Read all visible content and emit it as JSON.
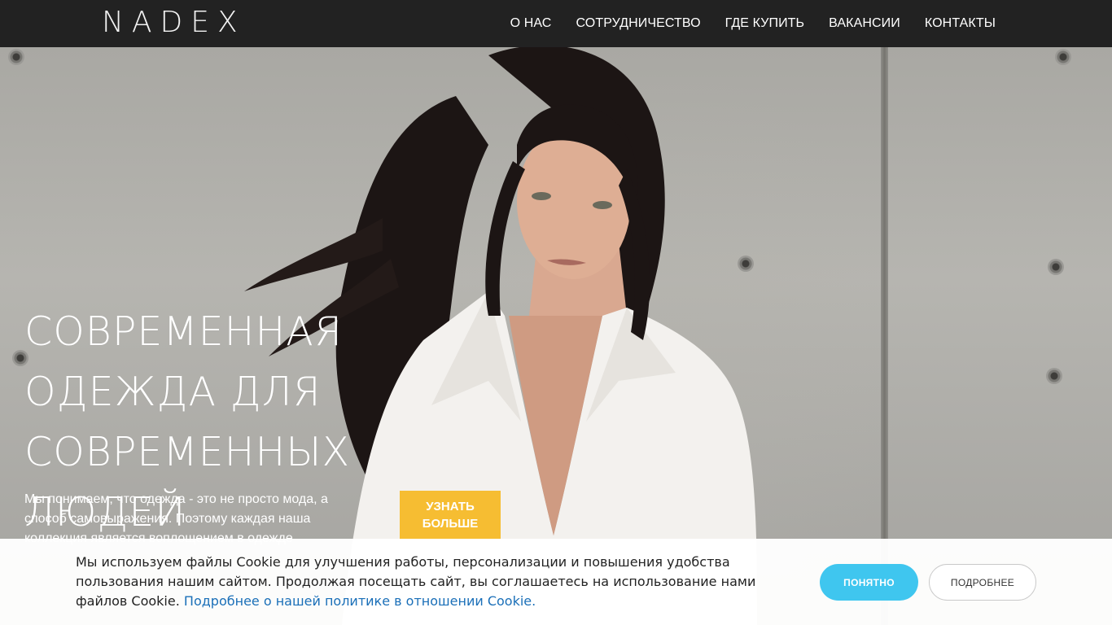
{
  "header": {
    "logo": "NADEX",
    "nav": [
      "О НАС",
      "СОТРУДНИЧЕСТВО",
      "ГДЕ КУПИТЬ",
      "ВАКАНСИИ",
      "КОНТАКТЫ"
    ]
  },
  "hero": {
    "title_lines": [
      "СОВРЕМЕННАЯ",
      "ОДЕЖДА ДЛЯ",
      "СОВРЕМЕННЫХ",
      "ЛЮДЕЙ"
    ],
    "text": "Мы понимаем, что одежда - это не просто мода, а способ самовыражения. Поэтому каждая наша коллекция является воплощением в одежде",
    "cta_line1": "УЗНАТЬ",
    "cta_line2": "БОЛЬШЕ"
  },
  "cookie": {
    "text": "Мы используем файлы Cookie для улучшения работы, персонализации и повышения удобства пользования нашим сайтом. Продолжая посещать сайт, вы соглашаетесь на использование нами файлов Cookie.",
    "link": "Подробнее о нашей политике в отношении Cookie.",
    "accept_label": "ПОНЯТНО",
    "more_label": "ПОДРОБНЕЕ"
  },
  "colors": {
    "header_bg": "#222222",
    "cta_bg": "#f6bd32",
    "accept_bg": "#3fc6ef",
    "link": "#1a6fb8"
  }
}
